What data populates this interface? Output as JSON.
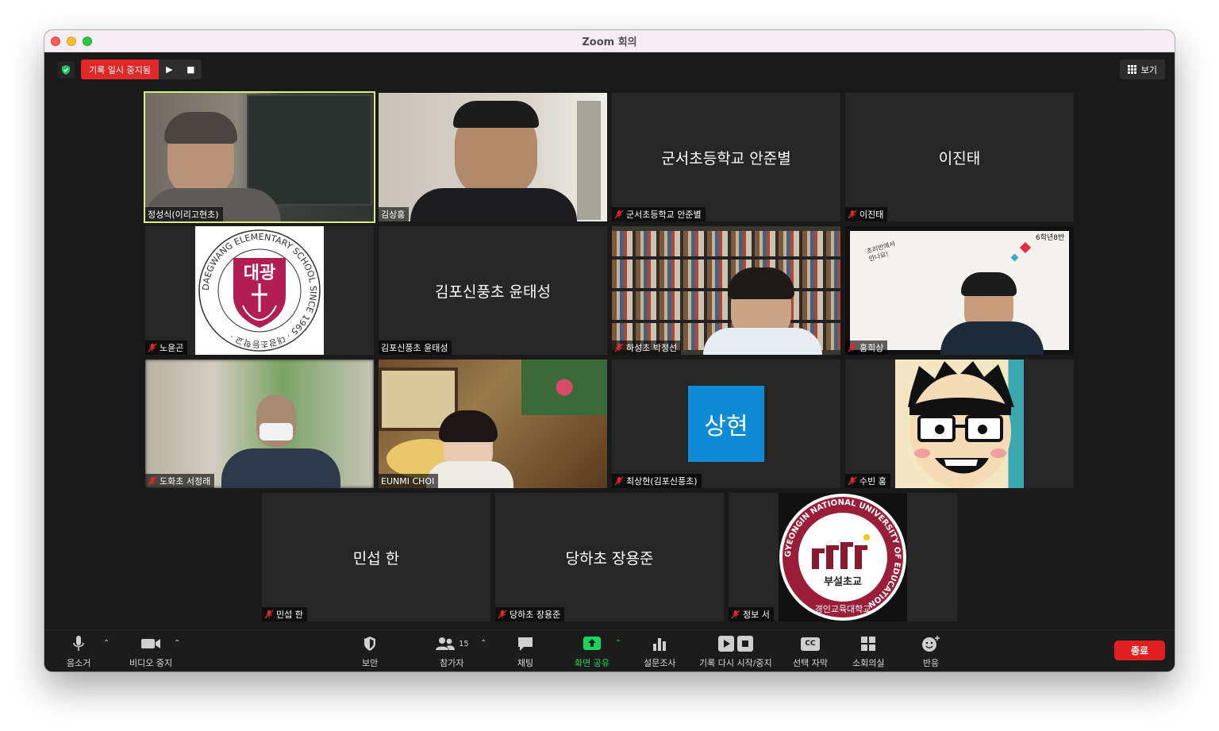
{
  "window": {
    "title": "Zoom 회의"
  },
  "recording": {
    "status": "기록 일시 중지됨",
    "resume_icon": "▶",
    "stop_icon": "■"
  },
  "view_button": {
    "label": "보기"
  },
  "participants": [
    {
      "name": "정성식(이리고현초)",
      "muted": false,
      "active_speaker": true
    },
    {
      "name": "김상홍",
      "muted": false
    },
    {
      "name": "군서초등학교 안준별",
      "display": "군서초등학교 안준별",
      "muted": true
    },
    {
      "name": "이진태",
      "display": "이진태",
      "muted": true
    },
    {
      "name": "노윤곤",
      "muted": true,
      "avatar_text": "대광",
      "logo_ring": "DAEGWANG ELEMENTARY SCHOOL SINCE 1965 · 대광초등학교 ·"
    },
    {
      "name": "김포신풍초 윤태성",
      "display": "김포신풍초 윤태성",
      "muted": false
    },
    {
      "name": "하성초 박정선",
      "muted": true
    },
    {
      "name": "홍희상",
      "muted": true,
      "slide_label": "6학년8반",
      "slide_text": "초리반에서 만나요!"
    },
    {
      "name": "도화초 서정래",
      "muted": true
    },
    {
      "name": "EUNMI CHOI",
      "muted": false
    },
    {
      "name": "최상현(김포신풍초)",
      "muted": true,
      "avatar_text": "상현",
      "avatar_color": "#0e8bd4"
    },
    {
      "name": "수빈 홍",
      "muted": true
    },
    {
      "name": "민섭 한",
      "display": "민섭 한",
      "muted": true
    },
    {
      "name": "당하초 장용준",
      "display": "당하초 장용준",
      "muted": true
    },
    {
      "name": "정보 서",
      "muted": true,
      "logo_ring": "GYEONGIN NATIONAL UNIVERSITY OF EDUCATION",
      "logo_bottom": "경인교육대학교",
      "logo_center": "부설초교"
    }
  ],
  "toolbar": {
    "mute": "음소거",
    "video": "비디오 중지",
    "security": "보안",
    "participants": "참가자",
    "participants_count": "15",
    "chat": "채팅",
    "share": "화면 공유",
    "polls": "설문조사",
    "record": "기록 다시 시작/중지",
    "captions": "선택 자막",
    "captions_icon_text": "CC",
    "breakout": "소회의실",
    "reactions": "반응",
    "end": "종료"
  },
  "colors": {
    "record_red": "#e02828",
    "share_green": "#17d55b",
    "active_border": "#d6f07a",
    "end_red": "#e02020"
  }
}
